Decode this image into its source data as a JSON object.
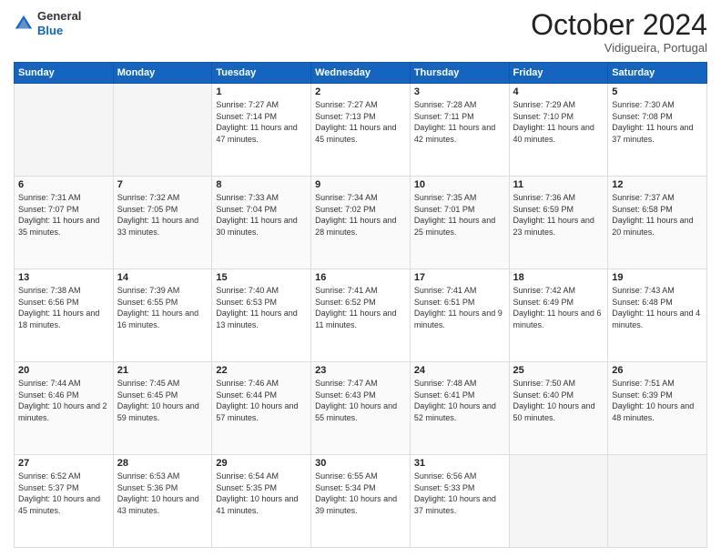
{
  "header": {
    "logo_line1": "General",
    "logo_line2": "Blue",
    "month_title": "October 2024",
    "location": "Vidigueira, Portugal"
  },
  "days_of_week": [
    "Sunday",
    "Monday",
    "Tuesday",
    "Wednesday",
    "Thursday",
    "Friday",
    "Saturday"
  ],
  "weeks": [
    [
      {
        "day": "",
        "empty": true
      },
      {
        "day": "",
        "empty": true
      },
      {
        "day": "1",
        "sunrise": "7:27 AM",
        "sunset": "7:14 PM",
        "daylight": "11 hours and 47 minutes."
      },
      {
        "day": "2",
        "sunrise": "7:27 AM",
        "sunset": "7:13 PM",
        "daylight": "11 hours and 45 minutes."
      },
      {
        "day": "3",
        "sunrise": "7:28 AM",
        "sunset": "7:11 PM",
        "daylight": "11 hours and 42 minutes."
      },
      {
        "day": "4",
        "sunrise": "7:29 AM",
        "sunset": "7:10 PM",
        "daylight": "11 hours and 40 minutes."
      },
      {
        "day": "5",
        "sunrise": "7:30 AM",
        "sunset": "7:08 PM",
        "daylight": "11 hours and 37 minutes."
      }
    ],
    [
      {
        "day": "6",
        "sunrise": "7:31 AM",
        "sunset": "7:07 PM",
        "daylight": "11 hours and 35 minutes."
      },
      {
        "day": "7",
        "sunrise": "7:32 AM",
        "sunset": "7:05 PM",
        "daylight": "11 hours and 33 minutes."
      },
      {
        "day": "8",
        "sunrise": "7:33 AM",
        "sunset": "7:04 PM",
        "daylight": "11 hours and 30 minutes."
      },
      {
        "day": "9",
        "sunrise": "7:34 AM",
        "sunset": "7:02 PM",
        "daylight": "11 hours and 28 minutes."
      },
      {
        "day": "10",
        "sunrise": "7:35 AM",
        "sunset": "7:01 PM",
        "daylight": "11 hours and 25 minutes."
      },
      {
        "day": "11",
        "sunrise": "7:36 AM",
        "sunset": "6:59 PM",
        "daylight": "11 hours and 23 minutes."
      },
      {
        "day": "12",
        "sunrise": "7:37 AM",
        "sunset": "6:58 PM",
        "daylight": "11 hours and 20 minutes."
      }
    ],
    [
      {
        "day": "13",
        "sunrise": "7:38 AM",
        "sunset": "6:56 PM",
        "daylight": "11 hours and 18 minutes."
      },
      {
        "day": "14",
        "sunrise": "7:39 AM",
        "sunset": "6:55 PM",
        "daylight": "11 hours and 16 minutes."
      },
      {
        "day": "15",
        "sunrise": "7:40 AM",
        "sunset": "6:53 PM",
        "daylight": "11 hours and 13 minutes."
      },
      {
        "day": "16",
        "sunrise": "7:41 AM",
        "sunset": "6:52 PM",
        "daylight": "11 hours and 11 minutes."
      },
      {
        "day": "17",
        "sunrise": "7:41 AM",
        "sunset": "6:51 PM",
        "daylight": "11 hours and 9 minutes."
      },
      {
        "day": "18",
        "sunrise": "7:42 AM",
        "sunset": "6:49 PM",
        "daylight": "11 hours and 6 minutes."
      },
      {
        "day": "19",
        "sunrise": "7:43 AM",
        "sunset": "6:48 PM",
        "daylight": "11 hours and 4 minutes."
      }
    ],
    [
      {
        "day": "20",
        "sunrise": "7:44 AM",
        "sunset": "6:46 PM",
        "daylight": "10 hours and 2 minutes."
      },
      {
        "day": "21",
        "sunrise": "7:45 AM",
        "sunset": "6:45 PM",
        "daylight": "10 hours and 59 minutes."
      },
      {
        "day": "22",
        "sunrise": "7:46 AM",
        "sunset": "6:44 PM",
        "daylight": "10 hours and 57 minutes."
      },
      {
        "day": "23",
        "sunrise": "7:47 AM",
        "sunset": "6:43 PM",
        "daylight": "10 hours and 55 minutes."
      },
      {
        "day": "24",
        "sunrise": "7:48 AM",
        "sunset": "6:41 PM",
        "daylight": "10 hours and 52 minutes."
      },
      {
        "day": "25",
        "sunrise": "7:50 AM",
        "sunset": "6:40 PM",
        "daylight": "10 hours and 50 minutes."
      },
      {
        "day": "26",
        "sunrise": "7:51 AM",
        "sunset": "6:39 PM",
        "daylight": "10 hours and 48 minutes."
      }
    ],
    [
      {
        "day": "27",
        "sunrise": "6:52 AM",
        "sunset": "5:37 PM",
        "daylight": "10 hours and 45 minutes."
      },
      {
        "day": "28",
        "sunrise": "6:53 AM",
        "sunset": "5:36 PM",
        "daylight": "10 hours and 43 minutes."
      },
      {
        "day": "29",
        "sunrise": "6:54 AM",
        "sunset": "5:35 PM",
        "daylight": "10 hours and 41 minutes."
      },
      {
        "day": "30",
        "sunrise": "6:55 AM",
        "sunset": "5:34 PM",
        "daylight": "10 hours and 39 minutes."
      },
      {
        "day": "31",
        "sunrise": "6:56 AM",
        "sunset": "5:33 PM",
        "daylight": "10 hours and 37 minutes."
      },
      {
        "day": "",
        "empty": true
      },
      {
        "day": "",
        "empty": true
      }
    ]
  ]
}
